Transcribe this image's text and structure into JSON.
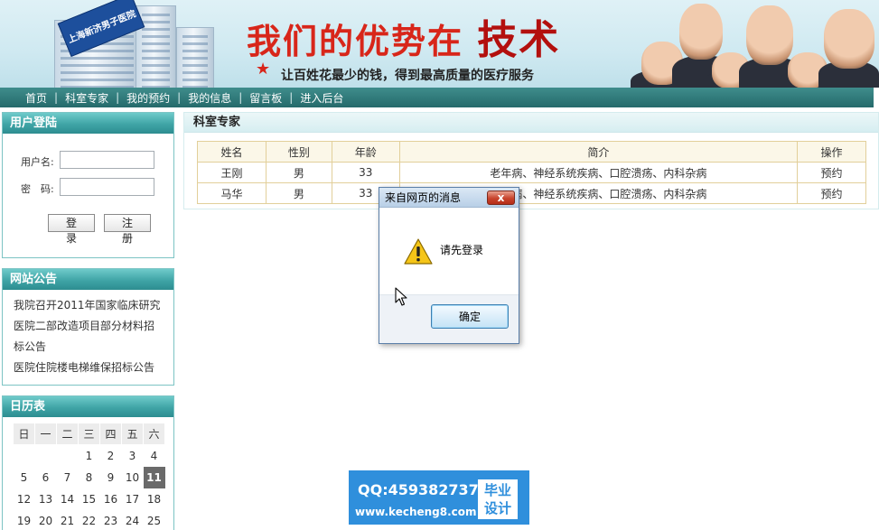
{
  "banner": {
    "sign_text": "上海新济男子医院",
    "slogan": "我们的优势在",
    "slogan_strong": "技术",
    "tagline": "让百姓花最少的钱，得到最高质量的医疗服务",
    "star_icon": "star-icon"
  },
  "nav": {
    "items": [
      "首页",
      "科室专家",
      "我的预约",
      "我的信息",
      "留言板",
      "进入后台"
    ],
    "separator": "|"
  },
  "login": {
    "title": "用户登陆",
    "username_label": "用户名:",
    "password_label": "密　码:",
    "username_value": "",
    "password_value": "",
    "login_button": "登 录",
    "register_button": "注 册"
  },
  "notice": {
    "title": "网站公告",
    "items": [
      "我院召开2011年国家临床研究",
      "医院二部改造项目部分材料招",
      "标公告",
      "医院住院楼电梯维保招标公告"
    ]
  },
  "calendar": {
    "title": "日历表",
    "weekdays": [
      "日",
      "一",
      "二",
      "三",
      "四",
      "五",
      "六"
    ],
    "rows": [
      [
        "",
        "",
        "",
        "1",
        "2",
        "3",
        "4"
      ],
      [
        "5",
        "6",
        "7",
        "8",
        "9",
        "10",
        "11"
      ],
      [
        "12",
        "13",
        "14",
        "15",
        "16",
        "17",
        "18"
      ],
      [
        "19",
        "20",
        "21",
        "22",
        "23",
        "24",
        "25"
      ]
    ],
    "today": "11"
  },
  "main": {
    "title": "科室专家",
    "headers": [
      "姓名",
      "性别",
      "年龄",
      "简介",
      "操作"
    ],
    "rows": [
      [
        "王刚",
        "男",
        "33",
        "老年病、神经系统疾病、口腔溃疡、内科杂病",
        "预约"
      ],
      [
        "马华",
        "男",
        "33",
        "老年病、神经系统疾病、口腔溃疡、内科杂病",
        "预约"
      ]
    ]
  },
  "dialog": {
    "title": "来自网页的消息",
    "close": "x",
    "message": "请先登录",
    "ok": "确定",
    "icon": "warning-icon"
  },
  "watermark": {
    "qq": "QQ:459382737",
    "url": "www.kecheng8.com",
    "badge_line1": "毕业",
    "badge_line2": "设计"
  },
  "colors": {
    "nav": "#2f7b7b",
    "panel_head": "#3fa4a6",
    "slogan": "#d8261a",
    "table_border": "#e2cf9a",
    "watermark": "#2f8fdc"
  }
}
